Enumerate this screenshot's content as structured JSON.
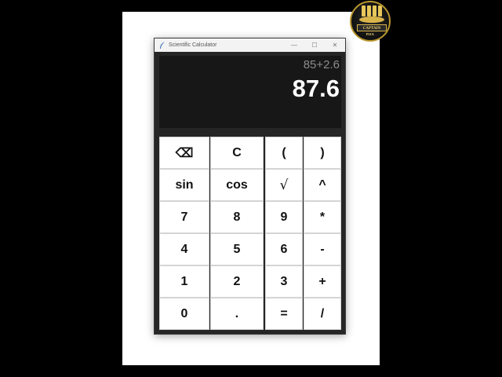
{
  "window": {
    "title": "Scientific Calculator",
    "controls": {
      "minimize": "—",
      "maximize": "☐",
      "close": "✕"
    }
  },
  "display": {
    "expression": "85+2.6",
    "result": "87.6"
  },
  "keys": [
    [
      "⌫",
      "C",
      "(",
      ")"
    ],
    [
      "sin",
      "cos",
      "√",
      "^"
    ],
    [
      "7",
      "8",
      "9",
      "*"
    ],
    [
      "4",
      "5",
      "6",
      "-"
    ],
    [
      "1",
      "2",
      "3",
      "+"
    ],
    [
      "0",
      ".",
      "=",
      "/"
    ]
  ],
  "logo": {
    "text": "CAPTAIN",
    "subtext": "PAUL"
  },
  "colors": {
    "background": "#000000",
    "window_body": "#262626",
    "display_bg": "#171717",
    "expression_text": "#8c8c8c",
    "result_text": "#ffffff",
    "key_bg": "#ffffff"
  }
}
